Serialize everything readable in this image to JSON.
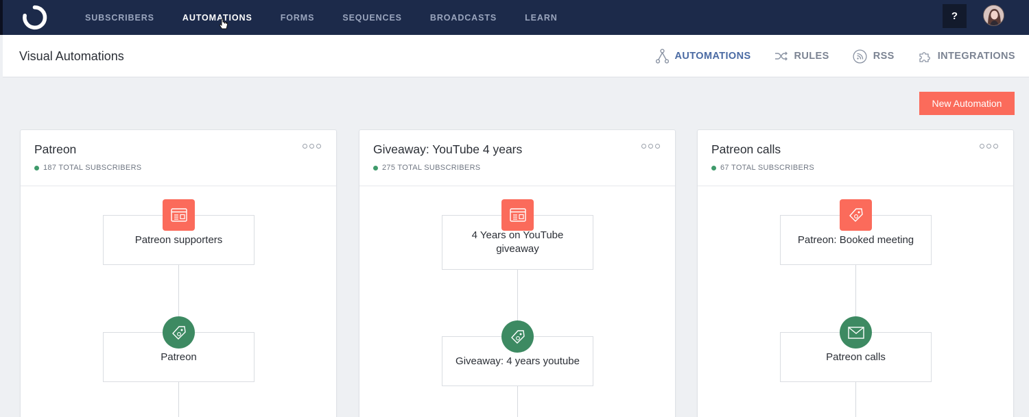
{
  "nav": {
    "items": [
      {
        "label": "SUBSCRIBERS"
      },
      {
        "label": "AUTOMATIONS"
      },
      {
        "label": "FORMS"
      },
      {
        "label": "SEQUENCES"
      },
      {
        "label": "BROADCASTS"
      },
      {
        "label": "LEARN"
      }
    ],
    "active": "AUTOMATIONS",
    "help_label": "?"
  },
  "header": {
    "title": "Visual Automations",
    "tabs": [
      {
        "label": "AUTOMATIONS",
        "icon": "automation-tree-icon"
      },
      {
        "label": "RULES",
        "icon": "shuffle-icon"
      },
      {
        "label": "RSS",
        "icon": "rss-icon"
      },
      {
        "label": "INTEGRATIONS",
        "icon": "puzzle-icon"
      }
    ],
    "active_tab": "AUTOMATIONS"
  },
  "actions": {
    "new_automation_label": "New Automation"
  },
  "colors": {
    "nav_bg": "#1c2a4a",
    "accent_coral": "#fb6b5b",
    "accent_green": "#3d8a62",
    "active_tab_blue": "#4a6aa3"
  },
  "cards": [
    {
      "title": "Patreon",
      "stat": "187 TOTAL SUBSCRIBERS",
      "nodes": [
        {
          "label": "Patreon supporters",
          "icon": "form-icon",
          "badge": "coral-square"
        },
        {
          "label": "Patreon",
          "icon": "tag-icon",
          "badge": "green-circle"
        }
      ]
    },
    {
      "title": "Giveaway: YouTube 4 years",
      "stat": "275 TOTAL SUBSCRIBERS",
      "nodes": [
        {
          "label": "4 Years on YouTube giveaway",
          "icon": "form-icon",
          "badge": "coral-square"
        },
        {
          "label": "Giveaway: 4 years youtube",
          "icon": "tag-icon",
          "badge": "green-circle"
        }
      ]
    },
    {
      "title": "Patreon calls",
      "stat": "67 TOTAL SUBSCRIBERS",
      "nodes": [
        {
          "label": "Patreon: Booked meeting",
          "icon": "tag-icon",
          "badge": "coral-square"
        },
        {
          "label": "Patreon calls",
          "icon": "envelope-icon",
          "badge": "green-circle"
        }
      ]
    }
  ]
}
